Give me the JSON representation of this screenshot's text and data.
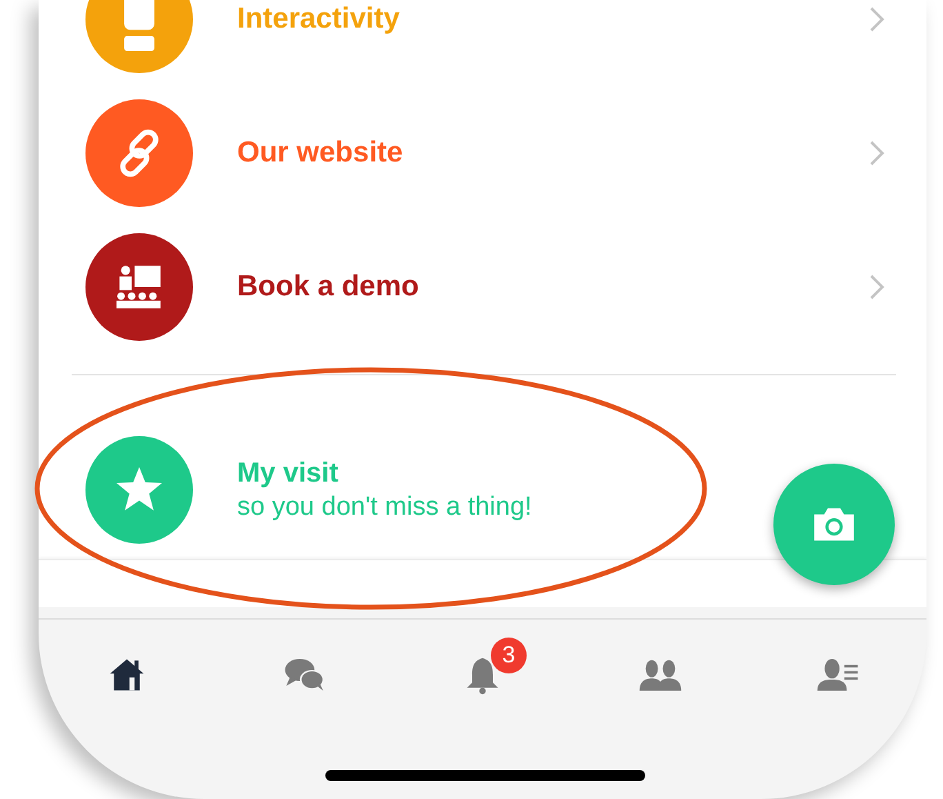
{
  "menu_items": [
    {
      "label": "Interactivity",
      "color": "#f4a20c"
    },
    {
      "label": "Our website",
      "color": "#ff5a22"
    },
    {
      "label": "Book a demo",
      "color": "#b01a1a"
    }
  ],
  "visit_item": {
    "title": "My visit",
    "subtitle": "so you don't miss a thing!",
    "color": "#1ec98a"
  },
  "tab_bar": [
    {
      "selected": true
    },
    {
      "selected": false
    },
    {
      "selected": false,
      "badge": "3"
    },
    {
      "selected": false
    },
    {
      "selected": false
    }
  ],
  "annotation": {
    "kind": "ellipse",
    "color": "#e4521b"
  }
}
